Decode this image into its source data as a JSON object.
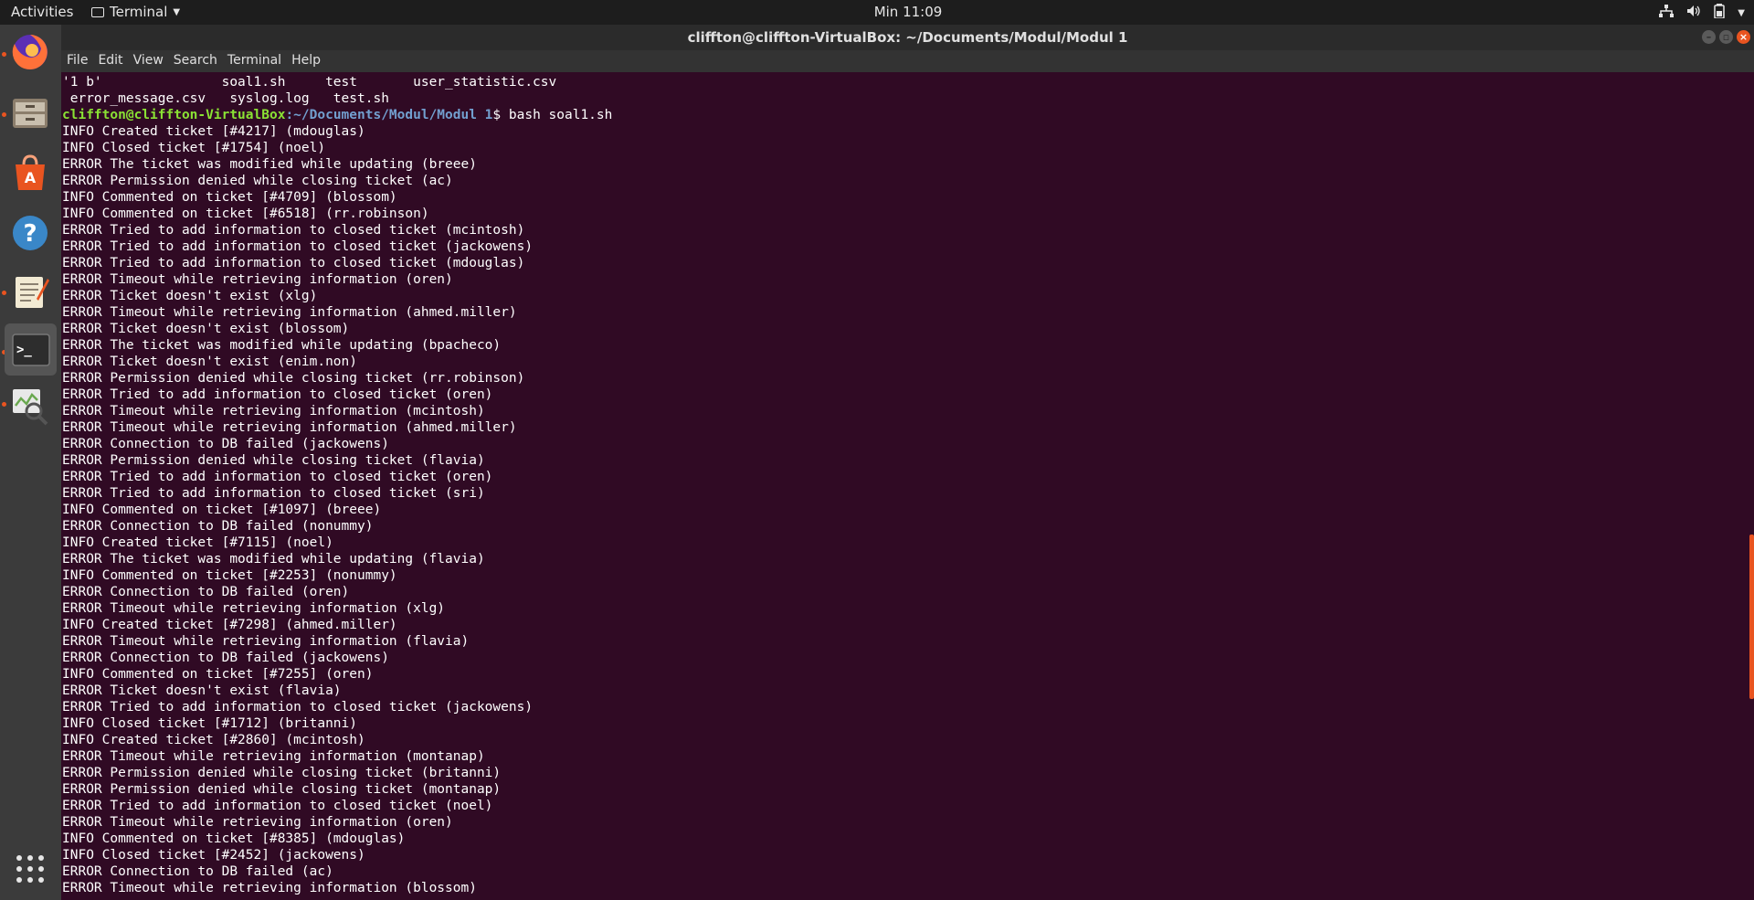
{
  "topbar": {
    "activities": "Activities",
    "app_menu": "Terminal",
    "clock": "Min 11:09"
  },
  "window": {
    "title": "cliffton@cliffton-VirtualBox: ~/Documents/Modul/Modul 1"
  },
  "menu": [
    "File",
    "Edit",
    "View",
    "Search",
    "Terminal",
    "Help"
  ],
  "terminal": {
    "ls_row1": "'1 b'               soal1.sh     test       user_statistic.csv",
    "ls_row2": " error_message.csv   syslog.log   test.sh",
    "prompt_user": "cliffton@cliffton-VirtualBox",
    "prompt_path": ":~/Documents/Modul/Modul 1",
    "prompt_cmd": "$ bash soal1.sh",
    "output": [
      "INFO Created ticket [#4217] (mdouglas)",
      "INFO Closed ticket [#1754] (noel)",
      "ERROR The ticket was modified while updating (breee)",
      "ERROR Permission denied while closing ticket (ac)",
      "INFO Commented on ticket [#4709] (blossom)",
      "INFO Commented on ticket [#6518] (rr.robinson)",
      "ERROR Tried to add information to closed ticket (mcintosh)",
      "ERROR Tried to add information to closed ticket (jackowens)",
      "ERROR Tried to add information to closed ticket (mdouglas)",
      "ERROR Timeout while retrieving information (oren)",
      "ERROR Ticket doesn't exist (xlg)",
      "ERROR Timeout while retrieving information (ahmed.miller)",
      "ERROR Ticket doesn't exist (blossom)",
      "ERROR The ticket was modified while updating (bpacheco)",
      "ERROR Ticket doesn't exist (enim.non)",
      "ERROR Permission denied while closing ticket (rr.robinson)",
      "ERROR Tried to add information to closed ticket (oren)",
      "ERROR Timeout while retrieving information (mcintosh)",
      "ERROR Timeout while retrieving information (ahmed.miller)",
      "ERROR Connection to DB failed (jackowens)",
      "ERROR Permission denied while closing ticket (flavia)",
      "ERROR Tried to add information to closed ticket (oren)",
      "ERROR Tried to add information to closed ticket (sri)",
      "INFO Commented on ticket [#1097] (breee)",
      "ERROR Connection to DB failed (nonummy)",
      "INFO Created ticket [#7115] (noel)",
      "ERROR The ticket was modified while updating (flavia)",
      "INFO Commented on ticket [#2253] (nonummy)",
      "ERROR Connection to DB failed (oren)",
      "ERROR Timeout while retrieving information (xlg)",
      "INFO Created ticket [#7298] (ahmed.miller)",
      "ERROR Timeout while retrieving information (flavia)",
      "ERROR Connection to DB failed (jackowens)",
      "INFO Commented on ticket [#7255] (oren)",
      "ERROR Ticket doesn't exist (flavia)",
      "ERROR Tried to add information to closed ticket (jackowens)",
      "INFO Closed ticket [#1712] (britanni)",
      "INFO Created ticket [#2860] (mcintosh)",
      "ERROR Timeout while retrieving information (montanap)",
      "ERROR Permission denied while closing ticket (britanni)",
      "ERROR Permission denied while closing ticket (montanap)",
      "ERROR Tried to add information to closed ticket (noel)",
      "ERROR Timeout while retrieving information (oren)",
      "INFO Commented on ticket [#8385] (mdouglas)",
      "INFO Closed ticket [#2452] (jackowens)",
      "ERROR Connection to DB failed (ac)",
      "ERROR Timeout while retrieving information (blossom)"
    ]
  },
  "dock": [
    {
      "name": "firefox-icon",
      "color": "#ff7139"
    },
    {
      "name": "files-icon",
      "color": "#9a8d7a"
    },
    {
      "name": "software-icon",
      "color": "#e95420"
    },
    {
      "name": "help-icon",
      "color": "#3a87c8"
    },
    {
      "name": "text-editor-icon",
      "color": "#f0e6c8"
    },
    {
      "name": "terminal-icon",
      "color": "#2d2d2d"
    },
    {
      "name": "system-monitor-icon",
      "color": "#6aa84f"
    }
  ]
}
